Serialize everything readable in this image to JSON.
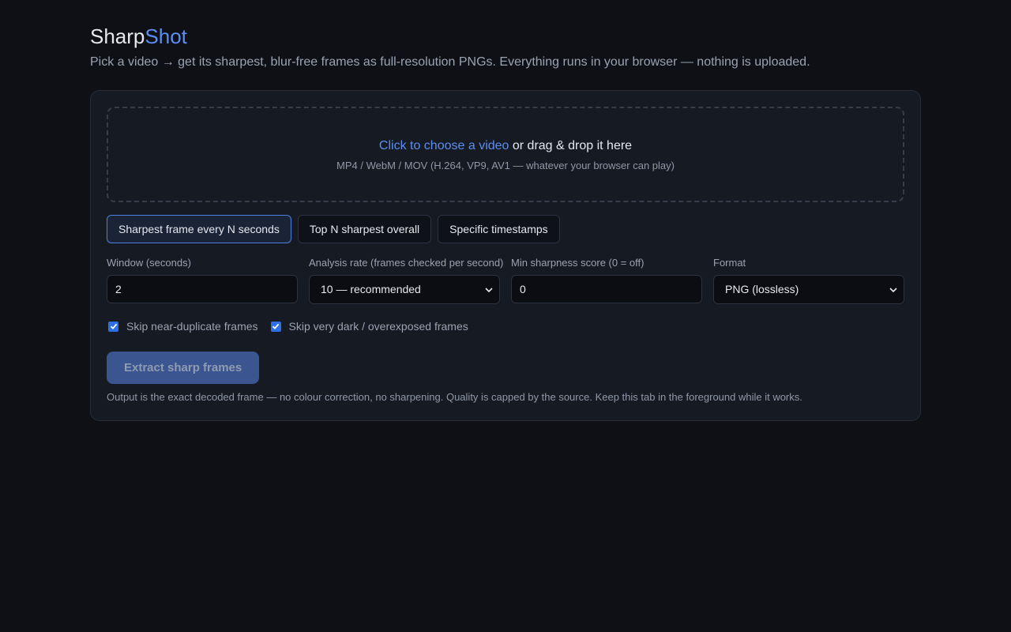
{
  "header": {
    "title_part1": "Sharp",
    "title_part2": "Shot",
    "subtitle": "Pick a video → get its sharpest, blur-free frames as full-resolution PNGs. Everything runs in your browser — nothing is uploaded."
  },
  "dropzone": {
    "link_text": "Click to choose a video",
    "rest_text": " or drag & drop it here",
    "formats": "MP4 / WebM / MOV (H.264, VP9, AV1 — whatever your browser can play)"
  },
  "tabs": [
    {
      "label": "Sharpest frame every N seconds",
      "active": true
    },
    {
      "label": "Top N sharpest overall",
      "active": false
    },
    {
      "label": "Specific timestamps",
      "active": false
    }
  ],
  "fields": {
    "window": {
      "label": "Window (seconds)",
      "value": "2"
    },
    "rate": {
      "label": "Analysis rate (frames checked per second)",
      "value": "10 — recommended"
    },
    "min_score": {
      "label": "Min sharpness score (0 = off)",
      "value": "0"
    },
    "format": {
      "label": "Format",
      "value": "PNG (lossless)"
    }
  },
  "checks": {
    "dup": {
      "label": "Skip near-duplicate frames",
      "checked": true
    },
    "dark": {
      "label": "Skip very dark / overexposed frames",
      "checked": true
    }
  },
  "action": {
    "extract_label": "Extract sharp frames",
    "note": "Output is the exact decoded frame — no colour correction, no sharpening. Quality is capped by the source. Keep this tab in the foreground while it works."
  },
  "colors": {
    "accent": "#5b8ef0",
    "background": "#0e1015",
    "card": "#161a22"
  }
}
